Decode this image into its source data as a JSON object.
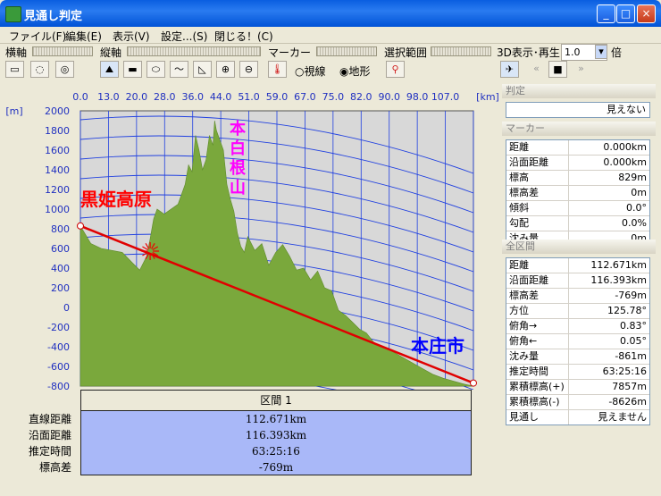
{
  "window": {
    "title": "見通し判定",
    "min": "_",
    "max": "□",
    "close": "×"
  },
  "menu": [
    {
      "label": "ファイル(F)"
    },
    {
      "label": "編集(E)"
    },
    {
      "label": "表示(V)"
    },
    {
      "label": "設定...(S)"
    },
    {
      "label": "閉じる！(C)"
    }
  ],
  "toolbar": {
    "horizontal_axis": "横軸",
    "vertical_axis": "縦軸",
    "marker": "マーカー",
    "selection": "選択範囲",
    "playback": "3D表示･再生",
    "speed_value": "1.0",
    "speed_unit": "倍",
    "radio_sightline": "視線",
    "radio_terrain": "地形",
    "radio_selected": "terrain"
  },
  "chart_data": {
    "type": "area",
    "x_unit": "[km]",
    "y_unit": "[m]",
    "x_ticks": [
      "0.0",
      "13.0",
      "20.0",
      "28.0",
      "36.0",
      "44.0",
      "51.0",
      "59.0",
      "67.0",
      "75.0",
      "82.0",
      "90.0",
      "98.0",
      "107.0"
    ],
    "y_ticks": [
      "2000",
      "1800",
      "1600",
      "1400",
      "1200",
      "1000",
      "800",
      "600",
      "400",
      "200",
      "0",
      "-200",
      "-400",
      "-600",
      "-800"
    ],
    "ylim": [
      -800,
      2000
    ],
    "xlim": [
      0,
      112.671
    ],
    "terrain_profile": {
      "x": [
        0,
        3,
        6,
        9,
        12,
        15,
        17,
        19,
        20,
        21,
        22,
        24,
        26,
        28,
        30,
        31,
        32,
        33,
        34,
        35,
        36,
        37,
        38,
        38.5,
        39,
        40,
        41,
        42,
        43,
        44,
        45,
        46,
        47,
        48,
        50,
        52,
        54,
        56,
        58,
        60,
        62,
        64,
        66,
        68,
        70,
        72,
        74,
        76,
        78,
        80,
        82,
        84,
        86,
        88,
        90,
        92,
        95,
        98,
        101,
        104,
        107,
        110,
        112.671
      ],
      "y": [
        829,
        650,
        600,
        580,
        560,
        450,
        380,
        520,
        700,
        900,
        1000,
        950,
        1000,
        1050,
        1250,
        1450,
        1380,
        1750,
        1600,
        1400,
        1500,
        1750,
        1650,
        1900,
        1800,
        1700,
        1600,
        1250,
        1100,
        980,
        760,
        620,
        560,
        720,
        580,
        650,
        430,
        560,
        640,
        520,
        380,
        400,
        280,
        370,
        200,
        170,
        -30,
        -80,
        -150,
        -220,
        -260,
        -350,
        -400,
        -420,
        -460,
        -500,
        -560,
        -620,
        -680,
        -720,
        -750,
        -780,
        -800
      ]
    },
    "sightline": {
      "from": {
        "x": 0,
        "y": 829
      },
      "to": {
        "x": 112.671,
        "y": -769
      }
    },
    "obstruction": {
      "x": 20,
      "y": 500
    },
    "labels": [
      {
        "text": "黒姫高原",
        "color": "#ff0000"
      },
      {
        "text": "本白根山",
        "color": "#ff00ff"
      },
      {
        "text": "本庄市",
        "color": "#0000ff"
      }
    ],
    "curve_color": "#2040e0",
    "terrain_color": "#7aa83c"
  },
  "interval": {
    "header": "区間 1",
    "labels": [
      "直線距離",
      "沿面距離",
      "推定時間",
      "標高差"
    ],
    "values": [
      "112.671km",
      "116.393km",
      "63:25:16",
      "-769m"
    ]
  },
  "judgement": {
    "head": "判定",
    "value": "見えない"
  },
  "marker": {
    "head": "マーカー",
    "rows": [
      {
        "k": "距離",
        "v": "0.000km"
      },
      {
        "k": "沿面距離",
        "v": "0.000km"
      },
      {
        "k": "標高",
        "v": "829m"
      },
      {
        "k": "標高差",
        "v": "0m"
      },
      {
        "k": "傾斜",
        "v": "0.0°"
      },
      {
        "k": "勾配",
        "v": "0.0%"
      },
      {
        "k": "沈み量",
        "v": "0m"
      }
    ]
  },
  "all_section": {
    "head": "全区間",
    "rows": [
      {
        "k": "距離",
        "v": "112.671km"
      },
      {
        "k": "沿面距離",
        "v": "116.393km"
      },
      {
        "k": "標高差",
        "v": "-769m"
      },
      {
        "k": "方位",
        "v": "125.78°"
      },
      {
        "k": "俯角→",
        "v": "0.83°"
      },
      {
        "k": "俯角←",
        "v": "0.05°"
      },
      {
        "k": "沈み量",
        "v": "-861m"
      },
      {
        "k": "推定時間",
        "v": "63:25:16"
      },
      {
        "k": "累積標高(+)",
        "v": "7857m"
      },
      {
        "k": "累積標高(-)",
        "v": "-8626m"
      },
      {
        "k": "見通し",
        "v": "見えません"
      }
    ]
  }
}
